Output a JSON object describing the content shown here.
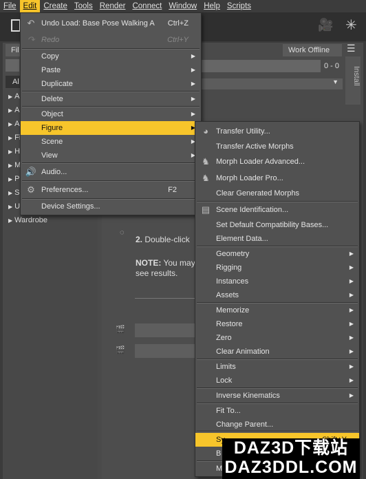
{
  "menubar": [
    "File",
    "Edit",
    "Create",
    "Tools",
    "Render",
    "Connect",
    "Window",
    "Help",
    "Scripts"
  ],
  "panel": {
    "tab": "Fil",
    "work_offline": "Work Offline",
    "range": "0 - 0",
    "side_tab": "Install",
    "filter_all": "Al"
  },
  "left_list": [
    "Ac",
    "An",
    "An",
    "Fig",
    "Ha",
    "Ma",
    "Po",
    "Sc",
    "Ut",
    "Wardrobe"
  ],
  "content": {
    "step": "2.",
    "step_text": "Double-click",
    "note_label": "NOTE:",
    "note_text": "You may",
    "note_text2": "see results."
  },
  "edit_menu": {
    "undo": {
      "label": "Undo Load: Base Pose Walking A",
      "shortcut": "Ctrl+Z"
    },
    "redo": {
      "label": "Redo",
      "shortcut": "Ctrl+Y"
    },
    "copy": "Copy",
    "paste": "Paste",
    "duplicate": "Duplicate",
    "delete": "Delete",
    "object": "Object",
    "figure": "Figure",
    "scene": "Scene",
    "view": "View",
    "audio": "Audio...",
    "preferences": {
      "label": "Preferences...",
      "shortcut": "F2"
    },
    "device_settings": "Device Settings..."
  },
  "figure_submenu": {
    "transfer_utility": "Transfer Utility...",
    "transfer_active_morphs": "Transfer Active Morphs",
    "morph_loader_advanced": "Morph Loader Advanced...",
    "morph_loader_pro": "Morph Loader Pro...",
    "clear_generated_morphs": "Clear Generated Morphs",
    "scene_identification": "Scene Identification...",
    "set_default_compat": "Set Default Compatibility Bases...",
    "element_data": "Element Data...",
    "geometry": "Geometry",
    "rigging": "Rigging",
    "instances": "Instances",
    "assets": "Assets",
    "memorize": "Memorize",
    "restore": "Restore",
    "zero": "Zero",
    "clear_animation": "Clear Animation",
    "limits": "Limits",
    "lock": "Lock",
    "inverse_kinematics": "Inverse Kinematics",
    "fit_to": "Fit To...",
    "change_parent": "Change Parent...",
    "symmetry": {
      "label": "Sy",
      "shortcut": "Shift+Y"
    },
    "b_item": "B",
    "m_item": "M"
  },
  "watermark": {
    "line1": "DAZ3D下载站",
    "line2": "DAZ3DDL.COM"
  },
  "colors": {
    "highlight": "#f7c52b",
    "menu_bg": "#555555"
  }
}
